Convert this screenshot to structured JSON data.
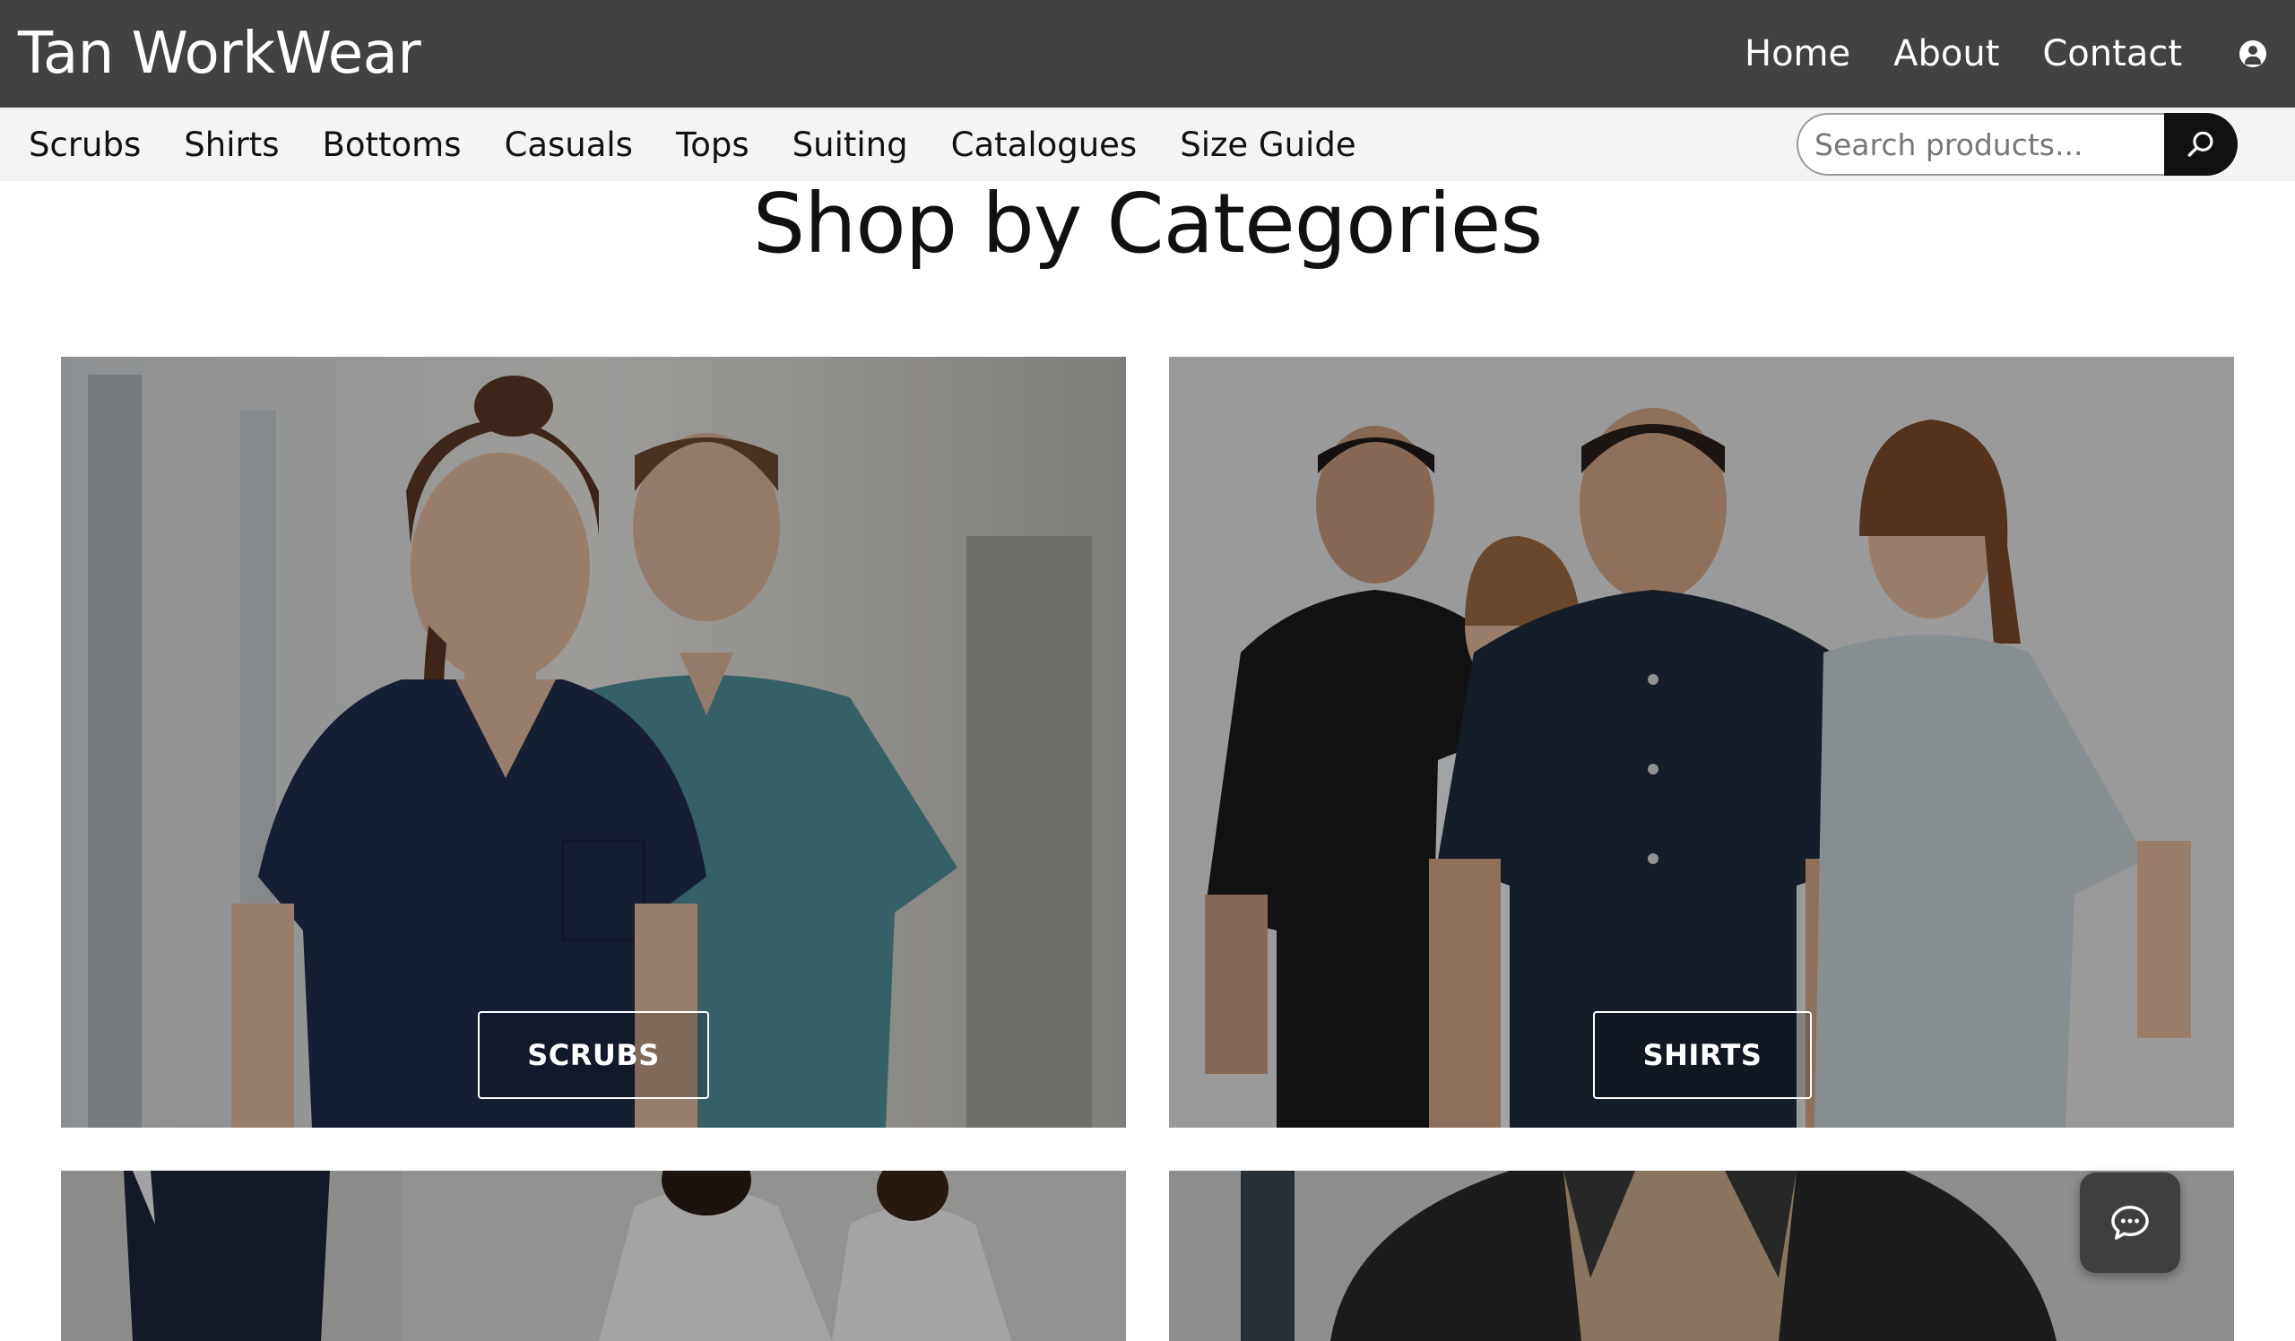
{
  "header": {
    "brand": "Tan WorkWear",
    "nav": [
      "Home",
      "About",
      "Contact"
    ],
    "user_icon": "user-circle-icon"
  },
  "catbar": {
    "items": [
      "Scrubs",
      "Shirts",
      "Bottoms",
      "Casuals",
      "Tops",
      "Suiting",
      "Catalogues",
      "Size Guide"
    ],
    "search_placeholder": "Search products...",
    "search_icon": "search-icon"
  },
  "main": {
    "title": "Shop by Categories",
    "tiles": [
      {
        "label": "SCRUBS"
      },
      {
        "label": "SHIRTS"
      }
    ]
  },
  "chat": {
    "icon": "chat-icon"
  },
  "colors": {
    "header_bg": "#424242",
    "catbar_bg": "#f4f4f4",
    "search_button": "#111111"
  }
}
